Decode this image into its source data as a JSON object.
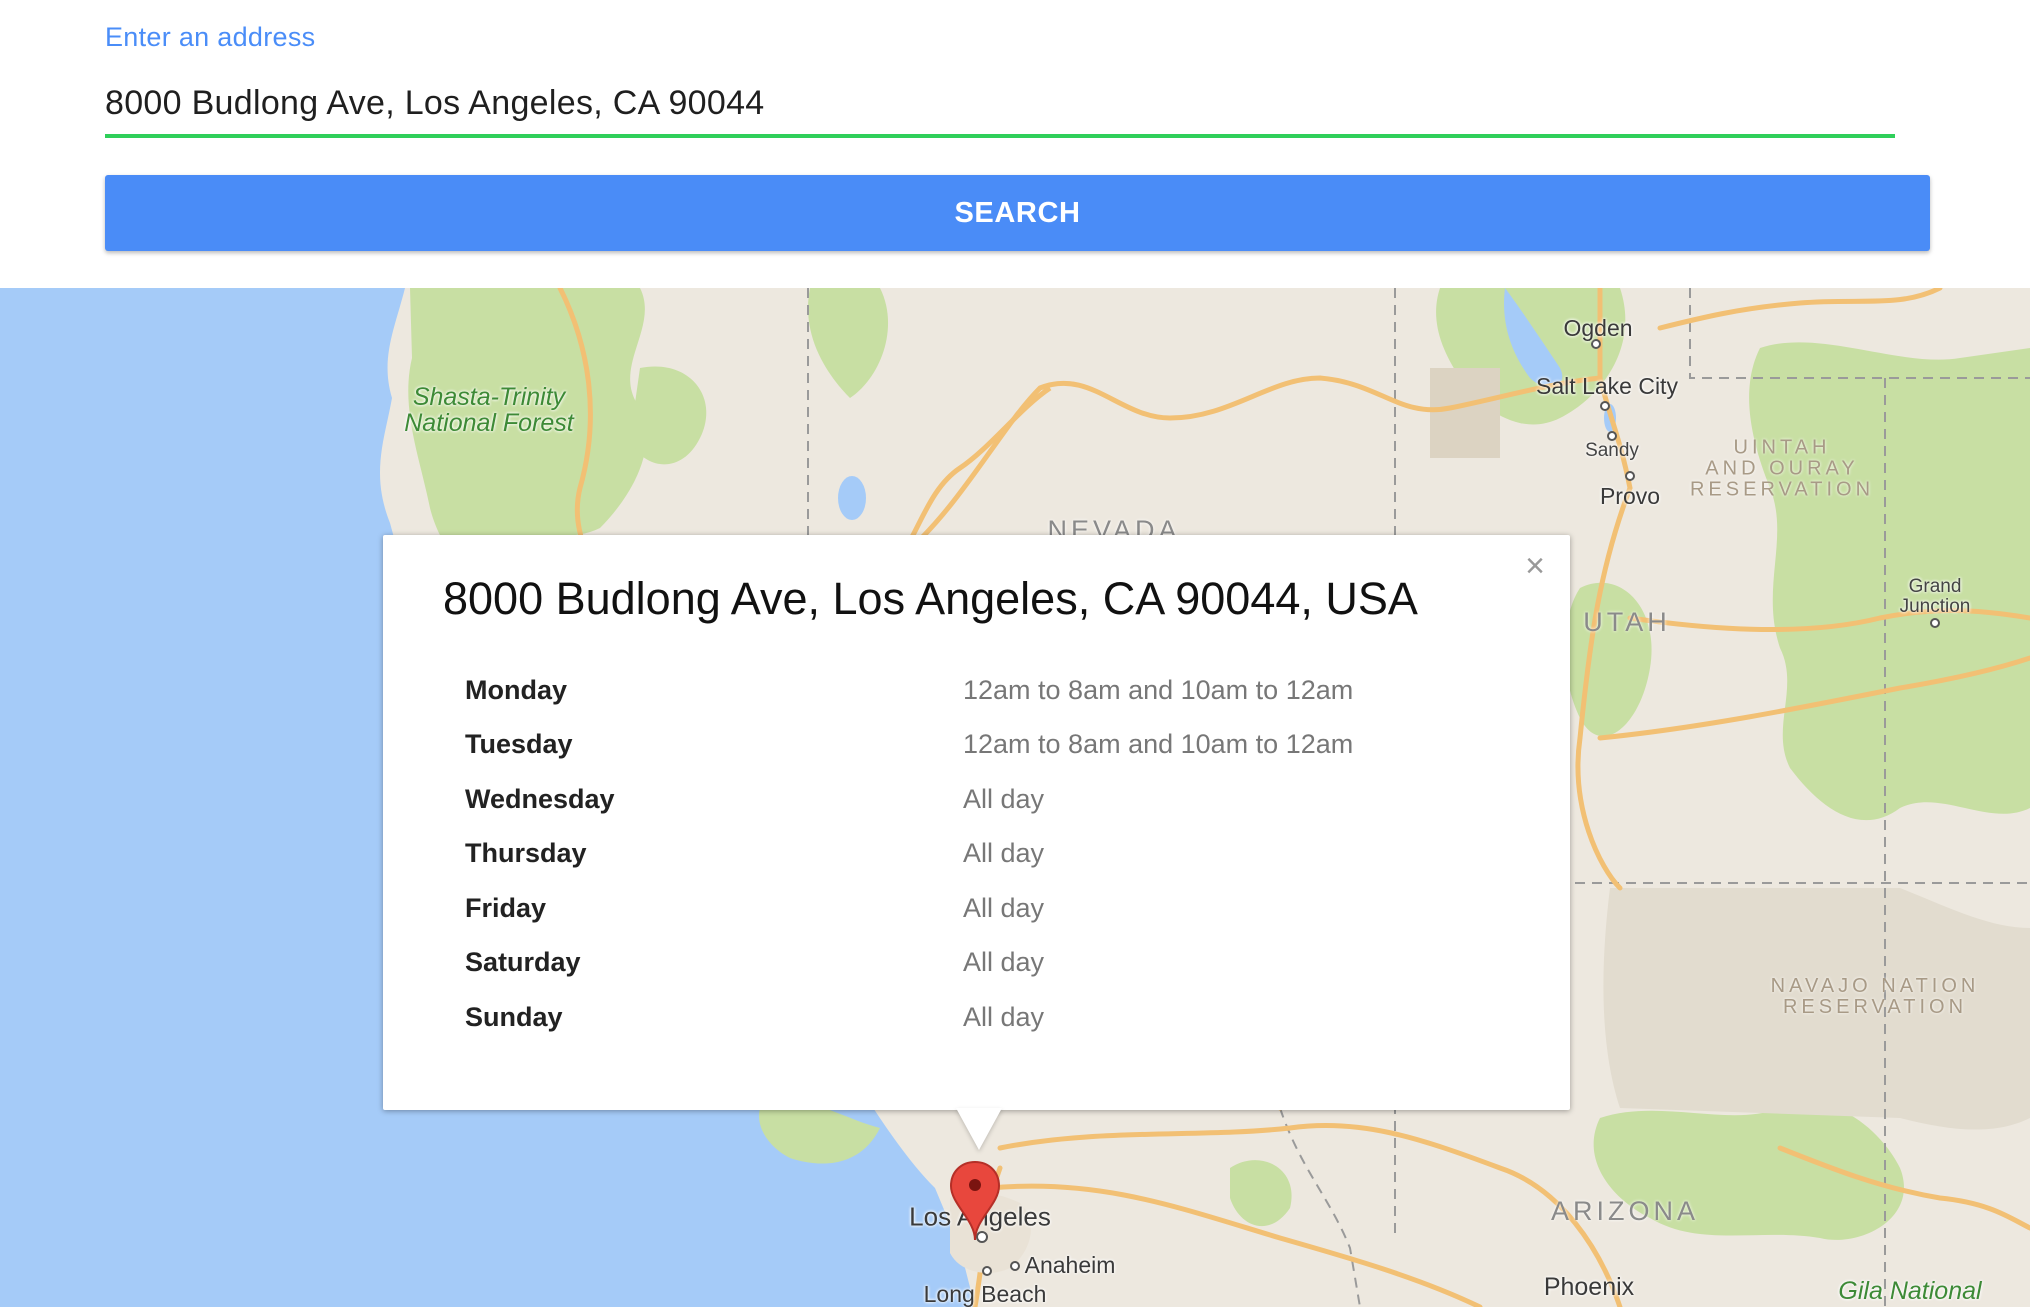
{
  "search": {
    "label": "Enter an address",
    "value": "8000 Budlong Ave, Los Angeles, CA 90044",
    "button_label": "SEARCH",
    "accent_color": "#4a8cf7",
    "underline_color": "#2fcf5a"
  },
  "map": {
    "labels": {
      "ogden": "Ogden",
      "salt_lake_city": "Salt Lake City",
      "sandy": "Sandy",
      "provo": "Provo",
      "shasta_trinity": "Shasta-Trinity\nNational Forest",
      "nevada": "NEVADA",
      "utah": "UTAH",
      "uintah": "UINTAH\nAND OURAY\nRESERVATION",
      "grand_junction": "Grand\nJunction",
      "navajo": "NAVAJO NATION\nRESERVATION",
      "arizona": "ARIZONA",
      "los_angeles": "Los Angeles",
      "anaheim": "Anaheim",
      "long_beach": "Long Beach",
      "phoenix": "Phoenix",
      "gila": "Gila National"
    },
    "water_color": "#a5cbf8",
    "land_color": "#ede8df",
    "park_color": "#c8dfa3",
    "road_color": "#f2c074"
  },
  "info_window": {
    "close_glyph": "×",
    "title": "8000 Budlong Ave, Los Angeles, CA 90044, USA",
    "hours": [
      {
        "day": "Monday",
        "hours": "12am to 8am and 10am to 12am"
      },
      {
        "day": "Tuesday",
        "hours": "12am to 8am and 10am to 12am"
      },
      {
        "day": "Wednesday",
        "hours": "All day"
      },
      {
        "day": "Thursday",
        "hours": "All day"
      },
      {
        "day": "Friday",
        "hours": "All day"
      },
      {
        "day": "Saturday",
        "hours": "All day"
      },
      {
        "day": "Sunday",
        "hours": "All day"
      }
    ]
  },
  "marker": {
    "icon": "map-pin-icon",
    "color": "#e8473d"
  }
}
